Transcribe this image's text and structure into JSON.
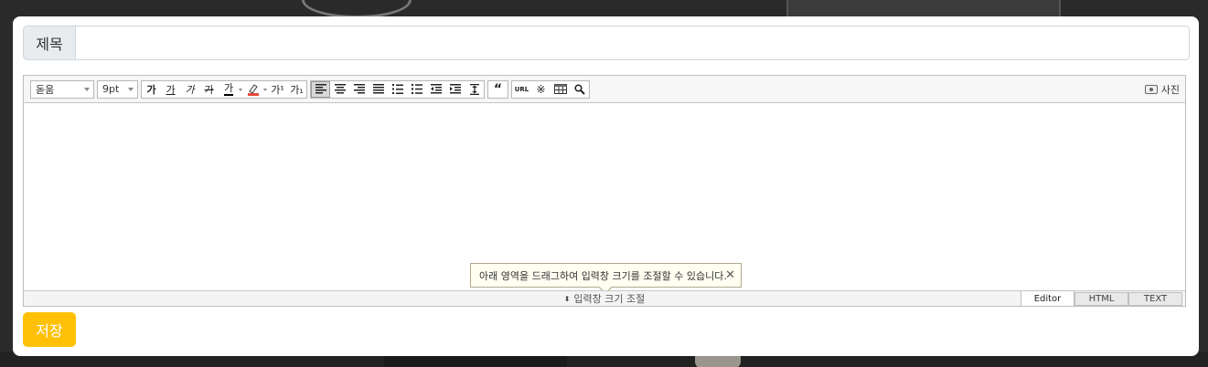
{
  "form": {
    "title_label": "제목",
    "title_value": "",
    "title_placeholder": "",
    "save_label": "저장"
  },
  "toolbar": {
    "font_family": "돋움",
    "font_size": "9pt",
    "photo_label": "사진",
    "bold_glyph": "가",
    "underline_glyph": "가",
    "italic_glyph": "가",
    "strike_glyph": "가",
    "font_color_glyph": "가",
    "superscript_glyph": "가¹",
    "subscript_glyph": "가₁",
    "quote_glyph": "“",
    "url_glyph": "URL",
    "special_char_glyph": "※",
    "table_glyph": "▦",
    "find_glyph": "⚲"
  },
  "editor": {
    "tooltip_text": "아래 영역을 드래그하여 입력창 크기를 조절할 수 있습니다.",
    "resize_label": "입력창 크기 조절",
    "resize_icon": "⬍",
    "modes": [
      "Editor",
      "HTML",
      "TEXT"
    ],
    "active_mode": "Editor"
  }
}
